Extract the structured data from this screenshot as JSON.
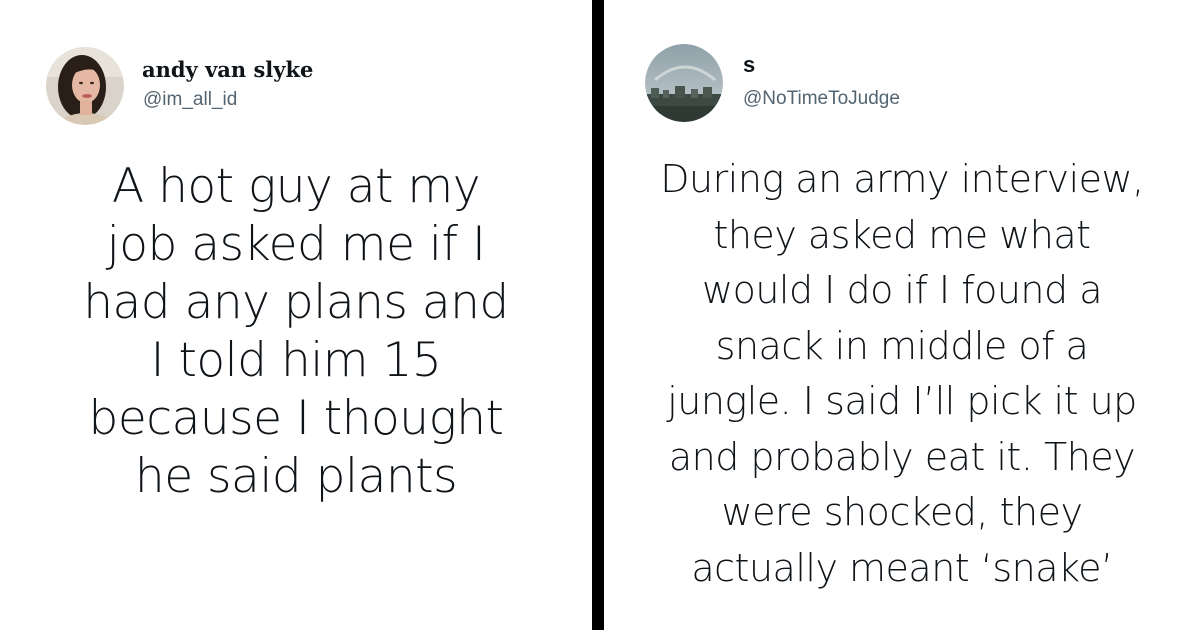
{
  "tweets": [
    {
      "display_name": "andy van slyke",
      "handle": "@im_all_id",
      "avatar_icon": "profile-photo-woman",
      "lines": [
        "A hot guy at my",
        "job asked me if I",
        "had any plans and",
        "I told him 15",
        "because I thought",
        "he said plants"
      ]
    },
    {
      "display_name": "s",
      "handle": "@NoTimeToJudge",
      "avatar_icon": "profile-photo-cityscape",
      "lines": [
        "During an army interview,",
        "they asked me what",
        "would I do if I found a",
        "snack in middle of a",
        "jungle. I said I’ll pick it up",
        "and probably eat it. They",
        "were shocked, they",
        "actually meant ‘snake’"
      ]
    }
  ],
  "colors": {
    "divider": "#000000",
    "text": "#0f1419",
    "handle": "#536471",
    "background": "#ffffff"
  }
}
